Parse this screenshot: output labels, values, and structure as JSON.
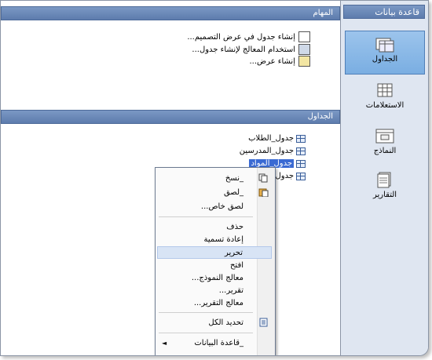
{
  "side_panel": {
    "title": "قاعدة بيانات",
    "items": [
      {
        "label": "الجداول",
        "icon": "tables-icon",
        "selected": true
      },
      {
        "label": "الاستعلامات",
        "icon": "queries-icon",
        "selected": false
      },
      {
        "label": "النماذج",
        "icon": "forms-icon",
        "selected": false
      },
      {
        "label": "التقارير",
        "icon": "reports-icon",
        "selected": false
      }
    ]
  },
  "tasks_pane": {
    "title": "المهام",
    "items": [
      {
        "label": "إنشاء جدول في عرض التصميم...",
        "icon": "design-view-icon"
      },
      {
        "label": "استخدام المعالج لإنشاء جدول...",
        "icon": "wizard-icon"
      },
      {
        "label": "إنشاء عرض...",
        "icon": "create-view-icon"
      }
    ]
  },
  "tables_pane": {
    "title": "الجداول",
    "items": [
      {
        "label": "جدول_الطلاب",
        "selected": false
      },
      {
        "label": "جدول_المدرسين",
        "selected": false
      },
      {
        "label": "جدول_المواد",
        "selected": true
      },
      {
        "label": "جدول_",
        "selected": false
      }
    ]
  },
  "context_menu": {
    "items": [
      {
        "label": "_نسخ",
        "icon": "copy-icon"
      },
      {
        "label": "_لصق",
        "icon": "paste-icon"
      },
      {
        "label": "لصق خاص...",
        "icon": ""
      },
      {
        "label": "حذف",
        "icon": ""
      },
      {
        "label": "إعادة تسمية",
        "icon": ""
      },
      {
        "label": "تحرير",
        "icon": "",
        "highlighted": true
      },
      {
        "label": "افتح",
        "icon": ""
      },
      {
        "label": "معالج النموذج...",
        "icon": ""
      },
      {
        "label": "تقرير...",
        "icon": ""
      },
      {
        "label": "معالج التقرير...",
        "icon": ""
      },
      {
        "label": "تحديد الكل",
        "icon": "select-all-icon"
      },
      {
        "label": "_قاعدة البيانات",
        "icon": "",
        "submenu": true
      }
    ]
  }
}
